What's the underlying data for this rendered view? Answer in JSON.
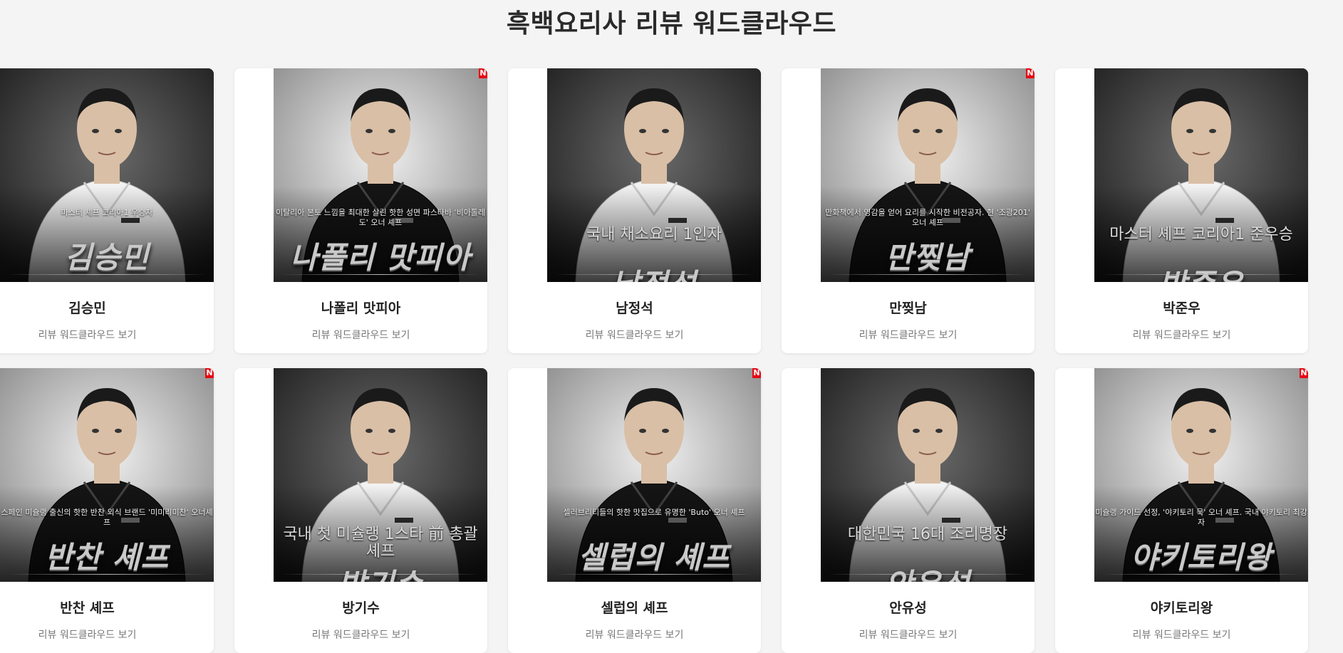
{
  "title": "흑백요리사 리뷰 워드클라우드",
  "cards": [
    {
      "name": "김승민",
      "link": "리뷰 워드클라우드 보기",
      "tagline": "마스터 셰프 코리아1 우승자",
      "nickname": "김승민",
      "jacket": "white",
      "bg": "#3a3a3a",
      "netflix": false,
      "tag_style": "small",
      "cut": false
    },
    {
      "name": "나폴리 맛피아",
      "link": "리뷰 워드클라우드 보기",
      "tagline": "이탈리아 본토 느낌을 최대한 살린 핫한 성면 파스타바 '비아톨레도' 오너 셰프",
      "nickname": "나폴리 맛피아",
      "jacket": "black",
      "bg": "#cfcfcf",
      "netflix": true,
      "tag_style": "small",
      "cut": false
    },
    {
      "name": "남정석",
      "link": "리뷰 워드클라우드 보기",
      "tagline": "국내 채소요리 1인자",
      "nickname": "남정석",
      "jacket": "white",
      "bg": "#444",
      "netflix": false,
      "tag_style": "big",
      "cut": true
    },
    {
      "name": "만찢남",
      "link": "리뷰 워드클라우드 보기",
      "tagline": "만화책에서 영감을 얻어 요리를 시작한 비전공자. 현 '조광201' 오너 셰프",
      "nickname": "만찢남",
      "jacket": "black",
      "bg": "#bdbdbd",
      "netflix": true,
      "tag_style": "small",
      "cut": false
    },
    {
      "name": "박준우",
      "link": "리뷰 워드클라우드 보기",
      "tagline": "마스터 셰프 코리아1 준우승",
      "nickname": "박준우",
      "jacket": "white",
      "bg": "#3c3c3c",
      "netflix": false,
      "tag_style": "big",
      "cut": true
    },
    {
      "name": "반찬 셰프",
      "link": "리뷰 워드클라우드 보기",
      "tagline": "스페인 미슐랭 출신의 핫한 반찬 외식 브랜드 '미미리미찬' 오너셰프",
      "nickname": "반찬 셰프",
      "jacket": "black",
      "bg": "#c8c8c8",
      "netflix": true,
      "tag_style": "small",
      "cut": false
    },
    {
      "name": "방기수",
      "link": "리뷰 워드클라우드 보기",
      "tagline": "국내 첫 미슐랭 1스타 前 총괄 셰프",
      "nickname": "방기수",
      "jacket": "white",
      "bg": "#3a3a3a",
      "netflix": false,
      "tag_style": "big",
      "cut": true
    },
    {
      "name": "셀럽의 셰프",
      "link": "리뷰 워드클라우드 보기",
      "tagline": "셀러브리티들의 핫한 맛집으로 유명한 'Buto' 오너 셰프",
      "nickname": "셀럽의 셰프",
      "jacket": "black",
      "bg": "#cacaca",
      "netflix": true,
      "tag_style": "small",
      "cut": false
    },
    {
      "name": "안유성",
      "link": "리뷰 워드클라우드 보기",
      "tagline": "대한민국 16대 조리명장",
      "nickname": "안유성",
      "jacket": "white",
      "bg": "#444",
      "netflix": false,
      "tag_style": "big",
      "cut": true
    },
    {
      "name": "야키토리왕",
      "link": "리뷰 워드클라우드 보기",
      "tagline": "미슐랭 가이드 선정, '야키토리 묵' 오너 셰프. 국내 야키토리 최강자",
      "nickname": "야키토리왕",
      "jacket": "black",
      "bg": "#c4c4c4",
      "netflix": true,
      "tag_style": "small",
      "cut": false
    }
  ],
  "netflix_mark": "N",
  "colors": {
    "background": "#f4f4f4",
    "card": "#ffffff",
    "netflix": "#e50914"
  }
}
